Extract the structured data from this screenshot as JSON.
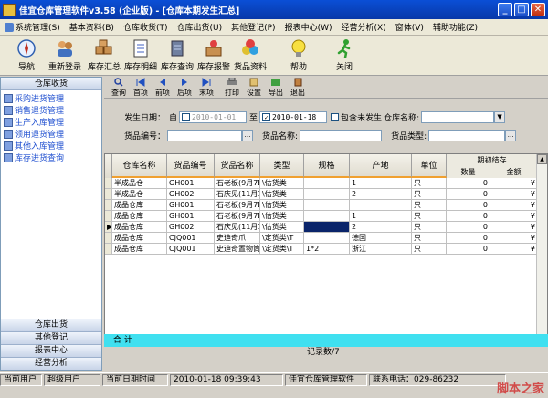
{
  "window": {
    "title": "佳宜仓库管理软件v3.58 (企业版) - [仓库本期发生汇总]"
  },
  "menu": [
    "系统管理(S)",
    "基本资料(B)",
    "仓库收货(T)",
    "仓库出货(U)",
    "其他登记(P)",
    "报表中心(W)",
    "经营分析(X)",
    "窗体(V)",
    "辅助功能(Z)"
  ],
  "toolbar": [
    "导航",
    "重新登录",
    "库存汇总",
    "库存明细",
    "库存查询",
    "库存报警",
    "货品资料",
    "帮助",
    "关闭"
  ],
  "left": {
    "header": "仓库收货",
    "items": [
      "采购进货管理",
      "销售退货管理",
      "生产入库管理",
      "领用退货管理",
      "其他入库管理",
      "库存进货查询"
    ],
    "categories": [
      "仓库出货",
      "其他登记",
      "报表中心",
      "经营分析"
    ]
  },
  "subtoolbar": [
    "查询",
    "首项",
    "前项",
    "后项",
    "末项",
    "打印",
    "设置",
    "导出",
    "退出"
  ],
  "filter": {
    "date_label": "发生日期：",
    "from_label": "自",
    "from_value": "2010-01-01",
    "to_label": "至",
    "to_value": "2010-01-18",
    "include_label": "包含未发生",
    "warehouse_label": "仓库名称:",
    "code_label": "货品编号：",
    "name_label": "货品名称:",
    "type_label": "货品类型:"
  },
  "grid": {
    "columns": [
      "仓库名称",
      "货品编号",
      "货品名称",
      "类型",
      "规格",
      "产地",
      "单位"
    ],
    "group": {
      "label": "期初结存",
      "sub": [
        "数量",
        "金额"
      ]
    },
    "rows": [
      [
        "半成品仓",
        "GH001",
        "石老板(9月7E",
        "\\估货类",
        "",
        "1",
        "只",
        "0",
        "¥"
      ],
      [
        "半成品仓",
        "GH002",
        "石庆见(11月1",
        "\\估货类",
        "",
        "2",
        "只",
        "0",
        "¥"
      ],
      [
        "成品仓库",
        "GH001",
        "石老板(9月7E",
        "\\估货类",
        "",
        "",
        "只",
        "0",
        "¥"
      ],
      [
        "成品仓库",
        "GH001",
        "石老板(9月7E",
        "\\估货类",
        "",
        "1",
        "只",
        "0",
        "¥"
      ],
      [
        "成品仓库",
        "GH002",
        "石庆见(11月1",
        "\\估货类",
        "",
        "2",
        "只",
        "0",
        "¥"
      ],
      [
        "成品仓库",
        "CJQ001",
        "史迪奇爪",
        "\\定货类\\T",
        "",
        "德国",
        "只",
        "0",
        "¥"
      ],
      [
        "成品仓库",
        "CJQ001",
        "史迪奇置物筒",
        "\\定货类\\T",
        "1*2",
        "浙江",
        "只",
        "0",
        "¥"
      ]
    ],
    "sum_label": "合  计",
    "record_count": "记录数/7"
  },
  "status": {
    "user_label": "当前用户",
    "user": "超级用户",
    "date_label": "当前日期时间",
    "datetime": "2010-01-18 09:39:43",
    "app": "佳宜仓库管理软件",
    "contact_label": "联系电话：",
    "phone": "029-86232"
  },
  "watermark": "脚本之家",
  "colors": {
    "title": "#0a4fd6",
    "sum_row": "#40e0f0",
    "link": "#2050d0",
    "selected_cell": "#0a246a"
  }
}
